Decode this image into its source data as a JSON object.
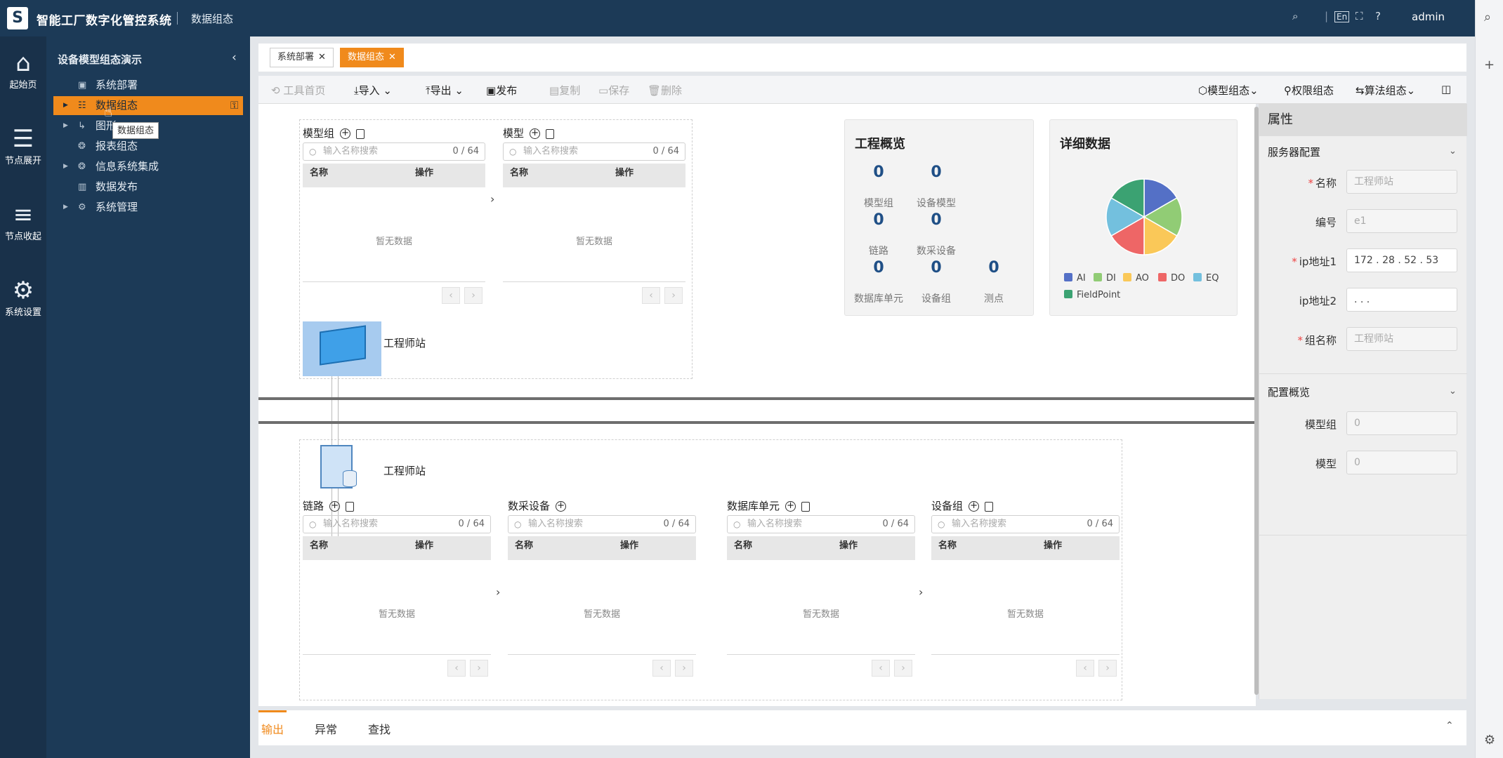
{
  "header": {
    "app_title": "智能工厂数字化管控系统",
    "breadcrumb": "数据组态",
    "user": "admin"
  },
  "left_nav": [
    {
      "label": "起始页",
      "icon": "home-icon"
    },
    {
      "label": "节点展开",
      "icon": "tree-expand-icon"
    },
    {
      "label": "节点收起",
      "icon": "list-collapse-icon"
    },
    {
      "label": "系统设置",
      "icon": "gear-icon"
    }
  ],
  "tree": {
    "title": "设备模型组态演示",
    "items": [
      {
        "label": "系统部署",
        "icon": "deploy-icon",
        "arrow": false
      },
      {
        "label": "数据组态",
        "icon": "data-config-icon",
        "arrow": true,
        "active": true
      },
      {
        "label": "图形",
        "icon": "graphic-icon",
        "arrow": true
      },
      {
        "label": "报表组态",
        "icon": "report-icon",
        "arrow": false
      },
      {
        "label": "信息系统集成",
        "icon": "integration-icon",
        "arrow": true
      },
      {
        "label": "数据发布",
        "icon": "publish-icon",
        "arrow": false
      },
      {
        "label": "系统管理",
        "icon": "system-icon",
        "arrow": true
      }
    ],
    "tooltip": "数据组态"
  },
  "tabs": [
    {
      "label": "系统部署",
      "active": false
    },
    {
      "label": "数据组态",
      "active": true
    }
  ],
  "toolbar": {
    "home": "工具首页",
    "import": "导入",
    "export": "导出",
    "publish": "发布",
    "copy": "复制",
    "save": "保存",
    "delete": "删除",
    "model_config": "模型组态",
    "perm_config": "权限组态",
    "algo_config": "算法组态"
  },
  "common": {
    "search_placeholder": "输入名称搜索",
    "count": "0 / 64",
    "col_name": "名称",
    "col_op": "操作",
    "empty": "暂无数据",
    "node_label": "工程师站"
  },
  "top_panels": [
    {
      "title": "模型组",
      "copy": true
    },
    {
      "title": "模型",
      "copy": true
    }
  ],
  "bottom_panels": [
    {
      "title": "链路",
      "copy": true
    },
    {
      "title": "数采设备",
      "copy": false
    },
    {
      "title": "数据库单元",
      "copy": true
    },
    {
      "title": "设备组",
      "copy": true
    }
  ],
  "overview": {
    "title": "工程概览",
    "stats": [
      {
        "label": "模型组",
        "value": "0"
      },
      {
        "label": "设备模型",
        "value": "0"
      },
      {
        "label": "链路",
        "value": "0"
      },
      {
        "label": "数采设备",
        "value": "0"
      },
      {
        "label": "数据库单元",
        "value": "0"
      },
      {
        "label": "设备组",
        "value": "0"
      },
      {
        "label": "测点",
        "value": "0"
      }
    ]
  },
  "detail": {
    "title": "详细数据"
  },
  "chart_data": {
    "type": "pie",
    "title": "详细数据",
    "labels": [
      "AI",
      "DI",
      "AO",
      "DO",
      "EQ",
      "FieldPoint"
    ],
    "values": [
      1,
      1,
      1,
      1,
      1,
      1
    ],
    "colors": [
      "#5470c6",
      "#91cc75",
      "#fac858",
      "#ee6666",
      "#73c0de",
      "#3ba272"
    ]
  },
  "properties": {
    "title": "属性",
    "server_section": "服务器配置",
    "overview_section": "配置概览",
    "fields": [
      {
        "label": "名称",
        "value": "工程师站",
        "required": true,
        "kind": "placeholder"
      },
      {
        "label": "编号",
        "value": "e1",
        "required": false,
        "kind": "placeholder"
      },
      {
        "label": "ip地址1",
        "value": "172 . 28 . 52 . 53",
        "required": true,
        "kind": "value"
      },
      {
        "label": "ip地址2",
        "value": ". . .",
        "required": false,
        "kind": "value"
      },
      {
        "label": "组名称",
        "value": "工程师站",
        "required": true,
        "kind": "placeholder"
      }
    ],
    "overview_fields": [
      {
        "label": "模型组",
        "value": "0"
      },
      {
        "label": "模型",
        "value": "0"
      }
    ]
  },
  "bottom_tabs": [
    {
      "label": "输出",
      "active": true
    },
    {
      "label": "异常",
      "active": false
    },
    {
      "label": "查找",
      "active": false
    }
  ]
}
